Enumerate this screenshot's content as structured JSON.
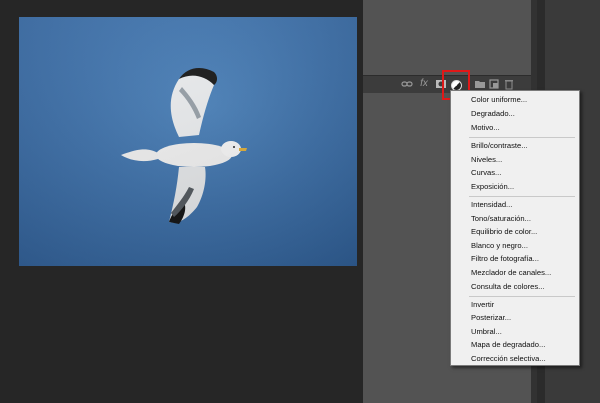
{
  "toolbar": {
    "icons": [
      "link-icon",
      "fx-icon",
      "mask-icon",
      "adjustment-layer-icon",
      "folder-icon",
      "new-layer-icon",
      "trash-icon"
    ],
    "fx_label": "fx"
  },
  "adjustment_menu": {
    "items": [
      "Color uniforme...",
      "Degradado...",
      "Motivo...",
      "Brillo/contraste...",
      "Niveles...",
      "Curvas...",
      "Exposición...",
      "Intensidad...",
      "Tono/saturación...",
      "Equilibrio de color...",
      "Blanco y negro...",
      "Filtro de fotografía...",
      "Mezclador de canales...",
      "Consulta de colores...",
      "Invertir",
      "Posterizar...",
      "Umbral...",
      "Mapa de degradado...",
      "Corrección selectiva..."
    ]
  },
  "colors": {
    "highlight": "#e01818",
    "sky": "#3f72ab",
    "menu_bg": "#f0f0f0"
  }
}
